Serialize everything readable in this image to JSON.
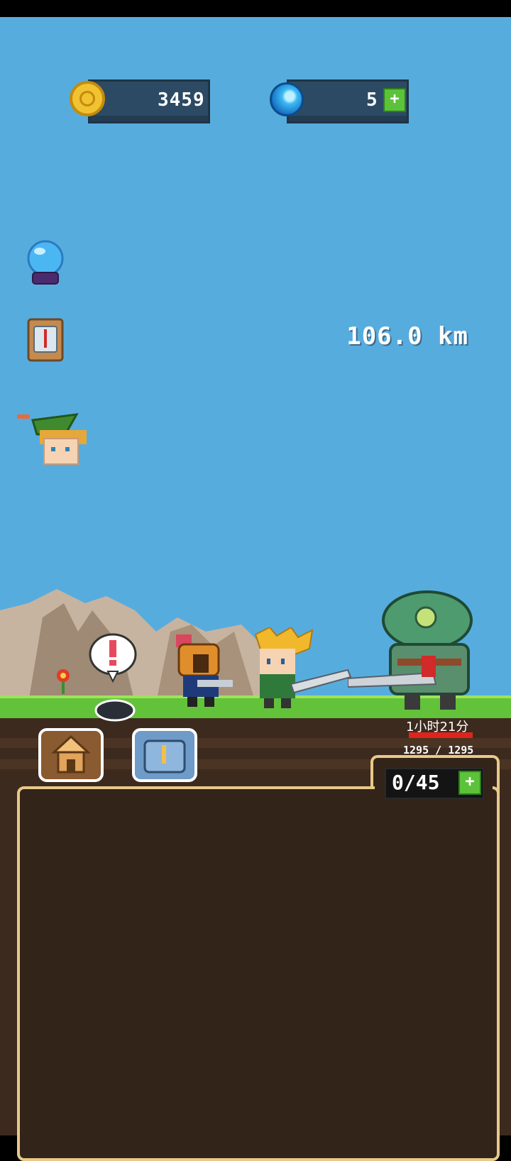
{
  "currency": {
    "coins": "3459",
    "gems": "5",
    "gems_plus_label": "+"
  },
  "hud": {
    "distance": "106.0 km"
  },
  "enemy": {
    "timer": "1小时21分",
    "hp_text": "1295 / 1295",
    "hp_fraction": 1.0
  },
  "inventory": {
    "capacity": "0/45",
    "plus_label": "+"
  },
  "colors": {
    "sky": "#57ACDE",
    "grass": "#62C23A",
    "dirt": "#3D2A1E",
    "panel_border": "#E8C98B",
    "hp_red": "#E0241B"
  },
  "icons": [
    "coin-icon",
    "gem-icon",
    "crystal-ball-icon",
    "compass-icon",
    "hero-head-icon",
    "house-icon",
    "chest-icon",
    "alert-bubble-icon"
  ]
}
